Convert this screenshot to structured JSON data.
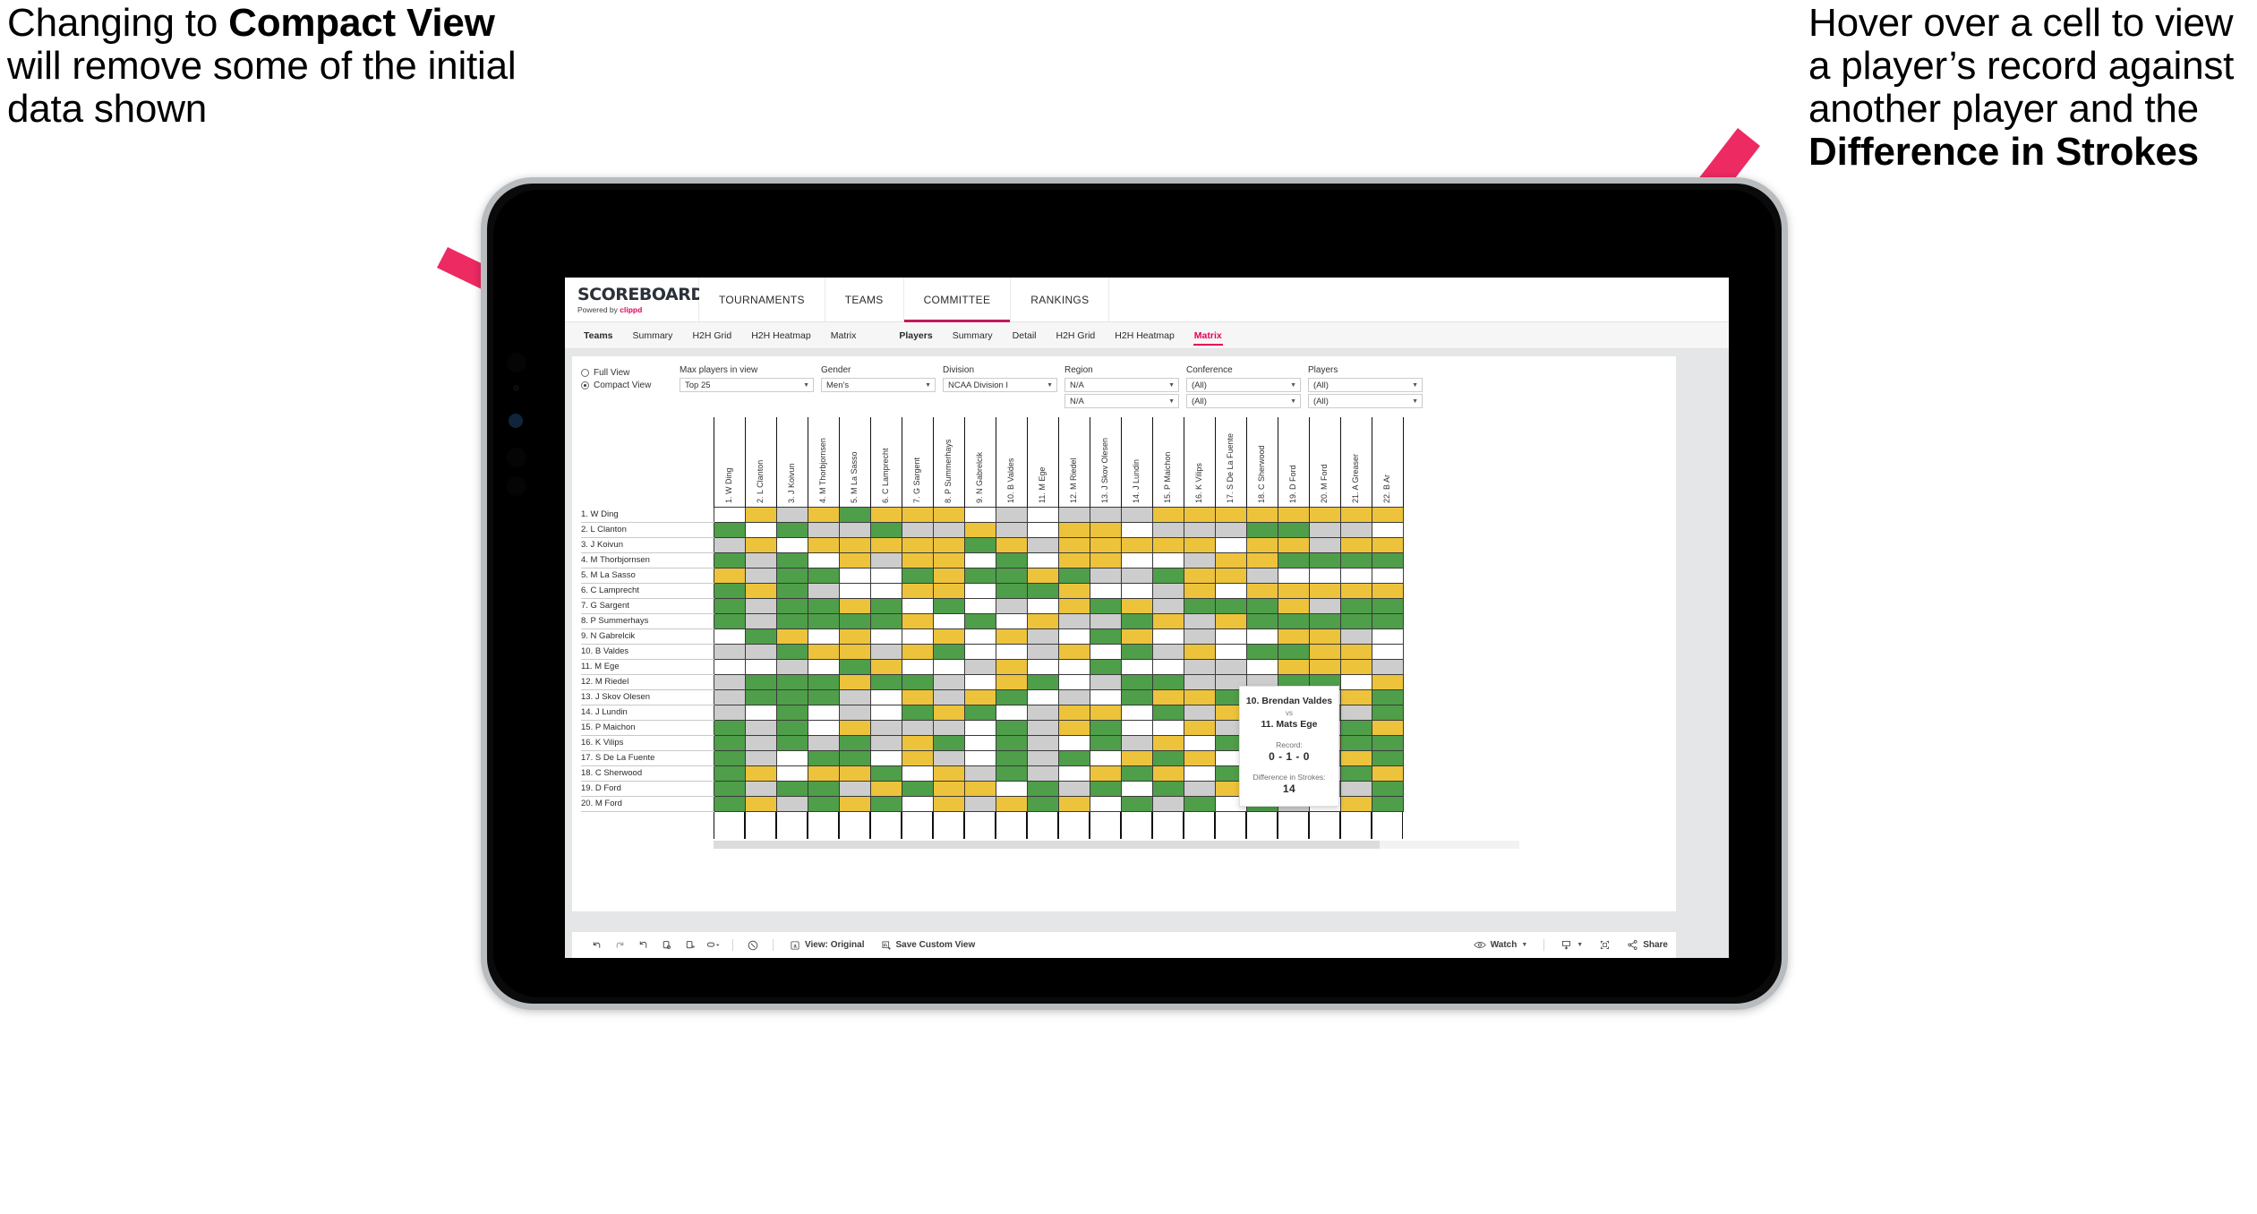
{
  "annotations": {
    "left": {
      "part1": "Changing to ",
      "bold": "Compact View",
      "part2": " will remove some of the initial data shown"
    },
    "right": {
      "part1": "Hover over a cell to view a player’s record against another player and the ",
      "bold": "Difference in Strokes"
    },
    "arrow_color": "#ee2a63"
  },
  "app": {
    "brand": {
      "title": "SCOREBOARD",
      "powered_prefix": "Powered by ",
      "powered_brand": "clippd"
    },
    "top_nav": [
      {
        "label": "TOURNAMENTS",
        "active": false
      },
      {
        "label": "TEAMS",
        "active": false
      },
      {
        "label": "COMMITTEE",
        "active": true
      },
      {
        "label": "RANKINGS",
        "active": false
      }
    ],
    "sub_nav_teams": [
      {
        "label": "Teams",
        "bold": true,
        "active": false
      },
      {
        "label": "Summary",
        "bold": false,
        "active": false
      },
      {
        "label": "H2H Grid",
        "bold": false,
        "active": false
      },
      {
        "label": "H2H Heatmap",
        "bold": false,
        "active": false
      },
      {
        "label": "Matrix",
        "bold": false,
        "active": false
      }
    ],
    "sub_nav_players": [
      {
        "label": "Players",
        "bold": true,
        "active": false
      },
      {
        "label": "Summary",
        "bold": false,
        "active": false
      },
      {
        "label": "Detail",
        "bold": false,
        "active": false
      },
      {
        "label": "H2H Grid",
        "bold": false,
        "active": false
      },
      {
        "label": "H2H Heatmap",
        "bold": false,
        "active": false
      },
      {
        "label": "Matrix",
        "bold": false,
        "active": true
      }
    ]
  },
  "filters": {
    "view_options": [
      {
        "label": "Full View",
        "selected": false
      },
      {
        "label": "Compact View",
        "selected": true
      }
    ],
    "selects": [
      {
        "label": "Max players in view",
        "value": "Top 25",
        "second": null
      },
      {
        "label": "Gender",
        "value": "Men’s",
        "second": null
      },
      {
        "label": "Division",
        "value": "NCAA Division I",
        "second": null
      },
      {
        "label": "Region",
        "value": "N/A",
        "second": "N/A"
      },
      {
        "label": "Conference",
        "value": "(All)",
        "second": "(All)"
      },
      {
        "label": "Players",
        "value": "(All)",
        "second": "(All)"
      }
    ]
  },
  "matrix": {
    "columns": [
      "1. W Ding",
      "2. L Clanton",
      "3. J Koivun",
      "4. M Thorbjornsen",
      "5. M La Sasso",
      "6. C Lamprecht",
      "7. G Sargent",
      "8. P Summerhays",
      "9. N Gabrelcik",
      "10. B Valdes",
      "11. M Ege",
      "12. M Riedel",
      "13. J Skov Olesen",
      "14. J Lundin",
      "15. P Maichon",
      "16. K Vilips",
      "17. S De La Fuente",
      "18. C Sherwood",
      "19. D Ford",
      "20. M Ford",
      "21. A Greaser",
      "22. B Ar"
    ],
    "rows": [
      "1. W Ding",
      "2. L Clanton",
      "3. J Koivun",
      "4. M Thorbjornsen",
      "5. M La Sasso",
      "6. C Lamprecht",
      "7. G Sargent",
      "8. P Summerhays",
      "9. N Gabrelcik",
      "10. B Valdes",
      "11. M Ege",
      "12. M Riedel",
      "13. J Skov Olesen",
      "14. J Lundin",
      "15. P Maichon",
      "16. K Vilips",
      "17. S De La Fuente",
      "18. C Sherwood",
      "19. D Ford",
      "20. M Ford"
    ],
    "legend": {
      "win": "#4f9e49",
      "loss": "#edc33c",
      "tie": "#cdcdcd",
      "none": "#ffffff"
    },
    "cells": [
      [
        "w",
        "y",
        "a",
        "y",
        "g",
        "y",
        "y",
        "y",
        "w",
        "a",
        "w",
        "a",
        "a",
        "a",
        "y",
        "y",
        "y",
        "y",
        "y",
        "y",
        "y",
        "y"
      ],
      [
        "g",
        "w",
        "g",
        "a",
        "a",
        "g",
        "a",
        "a",
        "y",
        "a",
        "w",
        "y",
        "y",
        "w",
        "a",
        "a",
        "a",
        "g",
        "g",
        "a",
        "a",
        "w"
      ],
      [
        "a",
        "y",
        "w",
        "y",
        "y",
        "y",
        "y",
        "y",
        "g",
        "y",
        "a",
        "y",
        "y",
        "y",
        "y",
        "y",
        "w",
        "y",
        "y",
        "a",
        "y",
        "y"
      ],
      [
        "g",
        "a",
        "g",
        "w",
        "y",
        "a",
        "y",
        "y",
        "w",
        "g",
        "w",
        "y",
        "y",
        "w",
        "w",
        "a",
        "y",
        "y",
        "g",
        "g",
        "g",
        "g"
      ],
      [
        "y",
        "a",
        "g",
        "g",
        "w",
        "w",
        "g",
        "y",
        "g",
        "g",
        "y",
        "g",
        "a",
        "a",
        "g",
        "y",
        "y",
        "a",
        "w",
        "w",
        "w",
        "w"
      ],
      [
        "g",
        "y",
        "g",
        "a",
        "w",
        "w",
        "y",
        "y",
        "w",
        "g",
        "g",
        "y",
        "w",
        "w",
        "a",
        "y",
        "w",
        "y",
        "y",
        "y",
        "y",
        "y"
      ],
      [
        "g",
        "a",
        "g",
        "g",
        "y",
        "g",
        "w",
        "g",
        "w",
        "a",
        "w",
        "y",
        "g",
        "y",
        "a",
        "g",
        "g",
        "g",
        "y",
        "a",
        "g",
        "g"
      ],
      [
        "g",
        "a",
        "g",
        "g",
        "g",
        "g",
        "y",
        "w",
        "g",
        "w",
        "y",
        "a",
        "a",
        "g",
        "y",
        "a",
        "y",
        "g",
        "g",
        "g",
        "g",
        "g"
      ],
      [
        "w",
        "g",
        "y",
        "w",
        "y",
        "w",
        "w",
        "y",
        "w",
        "y",
        "a",
        "w",
        "g",
        "y",
        "w",
        "a",
        "w",
        "w",
        "y",
        "y",
        "a",
        "w"
      ],
      [
        "a",
        "a",
        "g",
        "y",
        "y",
        "a",
        "y",
        "g",
        "w",
        "w",
        "a",
        "y",
        "w",
        "g",
        "a",
        "y",
        "w",
        "g",
        "g",
        "y",
        "y",
        "w"
      ],
      [
        "w",
        "w",
        "a",
        "w",
        "g",
        "y",
        "w",
        "w",
        "a",
        "y",
        "w",
        "w",
        "g",
        "w",
        "w",
        "a",
        "a",
        "w",
        "y",
        "y",
        "y",
        "a"
      ],
      [
        "a",
        "g",
        "g",
        "g",
        "y",
        "g",
        "g",
        "a",
        "w",
        "y",
        "g",
        "w",
        "a",
        "g",
        "g",
        "a",
        "a",
        "a",
        "g",
        "g",
        "w",
        "y"
      ],
      [
        "a",
        "g",
        "g",
        "g",
        "a",
        "w",
        "y",
        "a",
        "y",
        "g",
        "w",
        "a",
        "w",
        "g",
        "y",
        "y",
        "g",
        "a",
        "y",
        "a",
        "y",
        "g"
      ],
      [
        "a",
        "w",
        "g",
        "w",
        "a",
        "w",
        "g",
        "y",
        "g",
        "w",
        "a",
        "y",
        "y",
        "w",
        "g",
        "a",
        "y",
        "a",
        "y",
        "g",
        "a",
        "g"
      ],
      [
        "g",
        "a",
        "g",
        "w",
        "y",
        "a",
        "a",
        "a",
        "w",
        "g",
        "a",
        "y",
        "g",
        "w",
        "w",
        "y",
        "a",
        "g",
        "y",
        "a",
        "g",
        "y"
      ],
      [
        "g",
        "a",
        "g",
        "a",
        "g",
        "a",
        "y",
        "g",
        "w",
        "g",
        "a",
        "w",
        "g",
        "a",
        "y",
        "w",
        "g",
        "a",
        "a",
        "y",
        "g",
        "g"
      ],
      [
        "g",
        "a",
        "w",
        "g",
        "g",
        "w",
        "y",
        "a",
        "w",
        "g",
        "a",
        "g",
        "w",
        "y",
        "g",
        "y",
        "w",
        "a",
        "y",
        "g",
        "y",
        "g"
      ],
      [
        "g",
        "y",
        "w",
        "y",
        "y",
        "g",
        "w",
        "y",
        "a",
        "g",
        "a",
        "w",
        "y",
        "g",
        "y",
        "w",
        "g",
        "w",
        "y",
        "a",
        "g",
        "y"
      ],
      [
        "g",
        "a",
        "g",
        "g",
        "a",
        "y",
        "g",
        "y",
        "y",
        "w",
        "g",
        "a",
        "g",
        "w",
        "g",
        "a",
        "y",
        "y",
        "w",
        "g",
        "a",
        "g"
      ],
      [
        "g",
        "y",
        "a",
        "g",
        "y",
        "g",
        "w",
        "y",
        "a",
        "y",
        "g",
        "y",
        "w",
        "g",
        "a",
        "g",
        "w",
        "g",
        "a",
        "w",
        "y",
        "g"
      ]
    ]
  },
  "tooltip": {
    "player_a": "10. Brendan Valdes",
    "vs": "vs",
    "player_b": "11. Mats Ege",
    "record_label": "Record:",
    "record_value": "0 - 1 - 0",
    "strokes_label": "Difference in Strokes:",
    "strokes_value": "14"
  },
  "toolbar": {
    "icons": [
      "undo-icon",
      "redo-icon",
      "revert-icon",
      "refresh-icon",
      "pause-icon",
      "zoom-icon"
    ],
    "help_icon": "help-icon",
    "view_label": "View: Original",
    "save_label": "Save Custom View",
    "watch_label": "Watch",
    "share_label": "Share",
    "download_icon": "download-icon",
    "fullscreen_icon": "fullscreen-icon",
    "share_icon": "share-icon"
  }
}
